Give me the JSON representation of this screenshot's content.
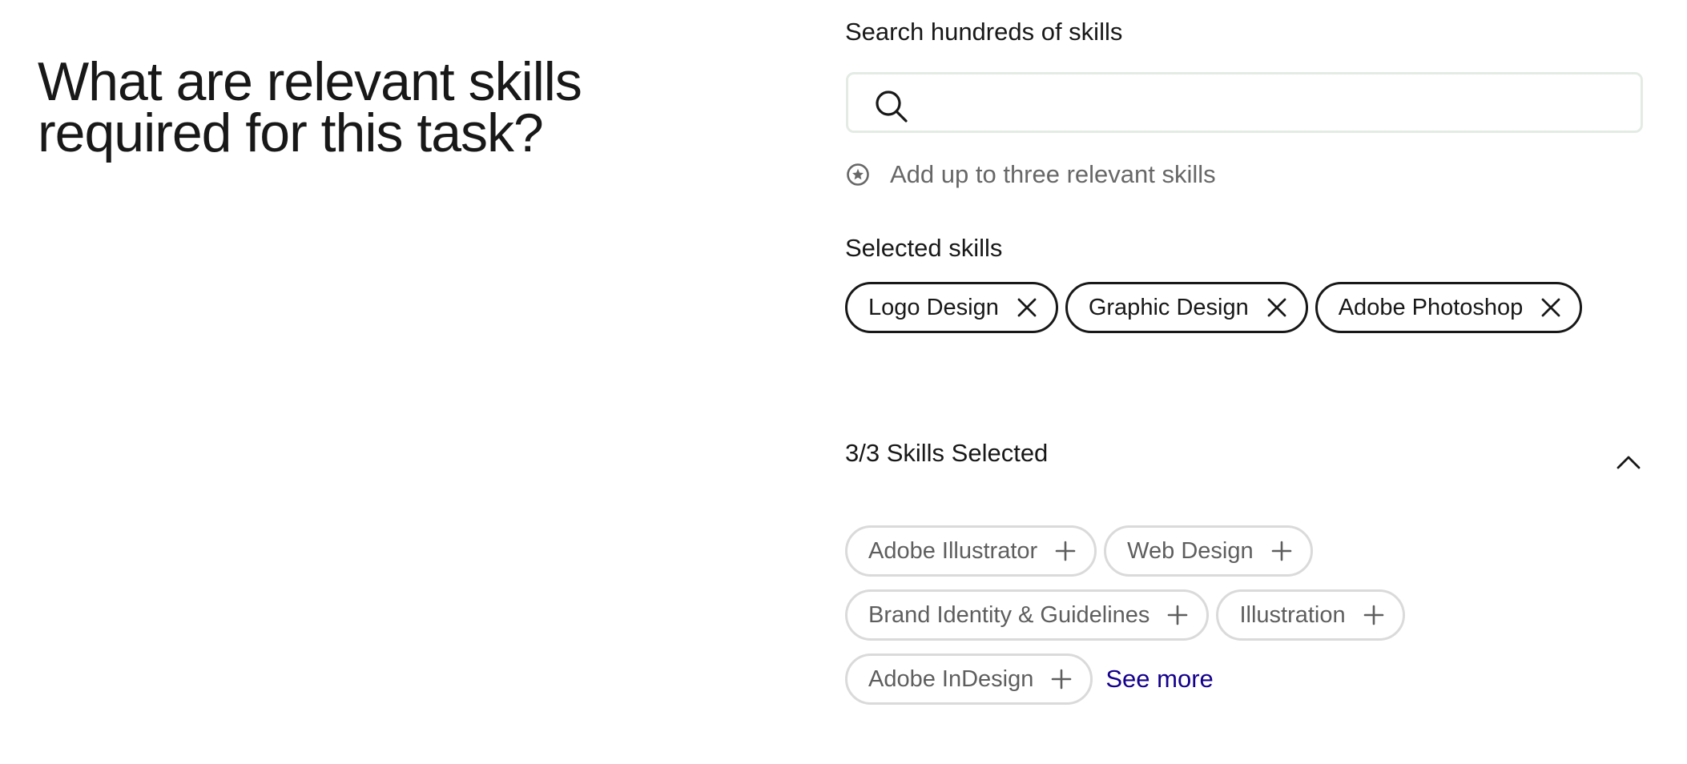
{
  "heading": {
    "line1": "What are relevant skills",
    "line2": "required for this task?"
  },
  "search": {
    "label": "Search hundreds of skills",
    "value": "",
    "placeholder": "",
    "hint": "Add up to three relevant skills"
  },
  "selected": {
    "label": "Selected skills",
    "skills": [
      "Logo Design",
      "Graphic Design",
      "Adobe Photoshop"
    ]
  },
  "suggestions": {
    "count_label": "3/3 Skills Selected",
    "skills": [
      "Adobe Illustrator",
      "Web Design",
      "Brand Identity & Guidelines",
      "Illustration",
      "Adobe InDesign"
    ],
    "see_more": "See more"
  },
  "icons": {
    "search": "search-icon",
    "hint": "badge-star-icon",
    "remove": "close-icon",
    "add": "plus-icon",
    "collapse": "chevron-up-icon"
  },
  "colors": {
    "text": "#181818",
    "muted": "#676767",
    "link": "#14008d",
    "chip_border_selected": "#181818",
    "chip_border_suggest": "#dadada"
  }
}
